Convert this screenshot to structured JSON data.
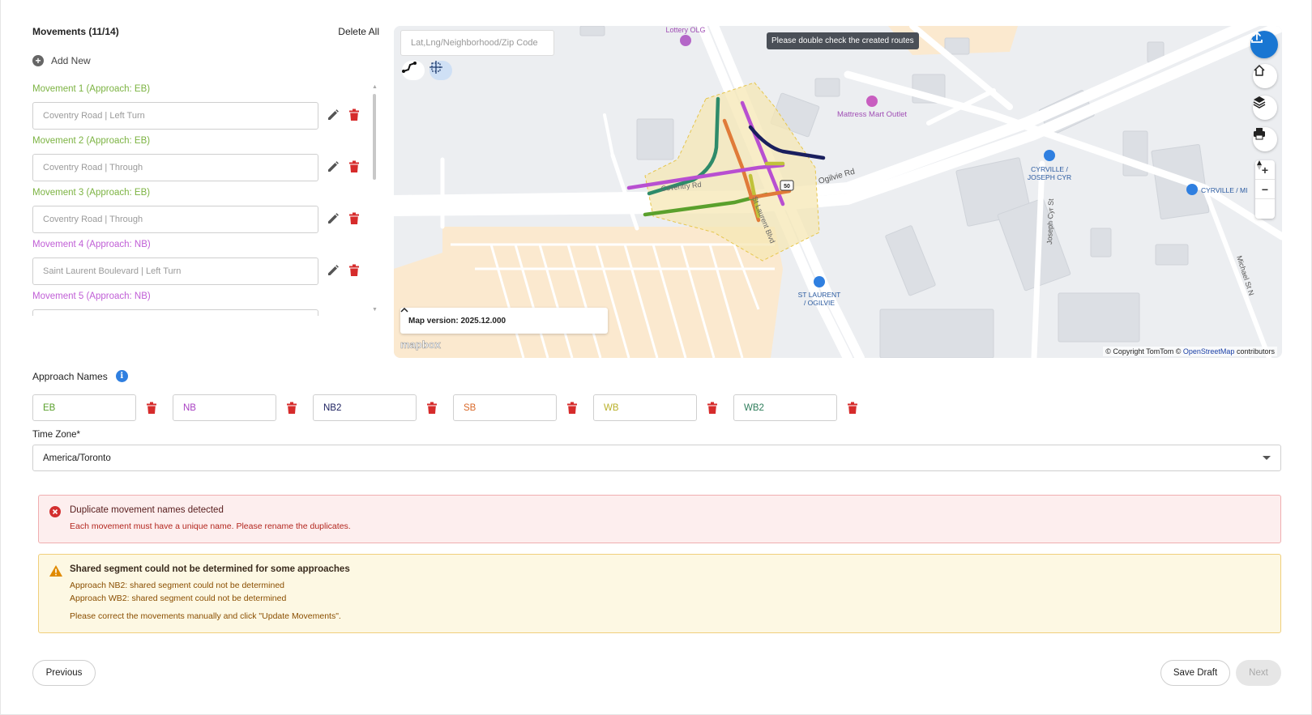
{
  "movements": {
    "title": "Movements (11/14)",
    "delete_all": "Delete All",
    "add_new": "Add New",
    "items": [
      {
        "label": "Movement 1 (Approach: EB)",
        "value": "Coventry Road | Left Turn",
        "color": "#7cb342"
      },
      {
        "label": "Movement 2 (Approach: EB)",
        "value": "Coventry Road | Through",
        "color": "#7cb342"
      },
      {
        "label": "Movement 3 (Approach: EB)",
        "value": "Coventry Road | Through",
        "color": "#7cb342"
      },
      {
        "label": "Movement 4 (Approach: NB)",
        "value": "Saint Laurent Boulevard | Left Turn",
        "color": "#c05ed6"
      },
      {
        "label": "Movement 5 (Approach: NB)",
        "value": "",
        "color": "#c05ed6"
      }
    ]
  },
  "map": {
    "search_placeholder": "Lat,Lng/Neighborhood/Zip Code",
    "tooltip": "Please double check the created routes",
    "version_label": "Map version: 2025.12.000",
    "logo": "mapbox",
    "attribution_prefix": "© Copyright TomTom ©",
    "attribution_link": "OpenStreetMap",
    "attribution_suffix": "contributors",
    "labels": {
      "lottery": "Lottery OLG",
      "mattress": "Mattress Mart Outlet",
      "cyrville_joseph_1": "CYRVILLE /",
      "cyrville_joseph_2": "JOSEPH CYR",
      "cyrville_mi": "CYRVILLE / MI",
      "st_laurent_1": "ST LAURENT",
      "st_laurent_2": "/ OGILVIE",
      "ogilvie_rd": "Ogilvie Rd",
      "coventry_rd": "Coventry Rd",
      "joseph_cyr_st": "Joseph Cyr St",
      "michael_st": "Michael St N",
      "st_laurent_blvd": "St Laurent Blvd",
      "route_shield": "50"
    },
    "route_colors": {
      "eb": "#5aa02c",
      "nb": "#b84fd1",
      "nb2": "#1a1f5e",
      "sb": "#e07b39",
      "wb": "#c0c23a",
      "wb2": "#2e8b6a"
    }
  },
  "approaches": {
    "title": "Approach Names",
    "info": "i",
    "items": [
      {
        "name": "EB",
        "color": "#5aa02c"
      },
      {
        "name": "NB",
        "color": "#a83fc2"
      },
      {
        "name": "NB2",
        "color": "#1a1f5e"
      },
      {
        "name": "SB",
        "color": "#d9692a"
      },
      {
        "name": "WB",
        "color": "#b9b02a"
      },
      {
        "name": "WB2",
        "color": "#2e7d5b"
      }
    ]
  },
  "timezone": {
    "label": "Time Zone*",
    "value": "America/Toronto"
  },
  "alerts": {
    "error": {
      "title": "Duplicate movement names detected",
      "message": "Each movement must have a unique name. Please rename the duplicates."
    },
    "warning": {
      "title": "Shared segment could not be determined for some approaches",
      "lines": [
        "Approach NB2: shared segment could not be determined",
        "Approach WB2: shared segment could not be determined"
      ],
      "footer": "Please correct the movements manually and click \"Update Movements\"."
    }
  },
  "buttons": {
    "previous": "Previous",
    "save_draft": "Save Draft",
    "next": "Next"
  }
}
